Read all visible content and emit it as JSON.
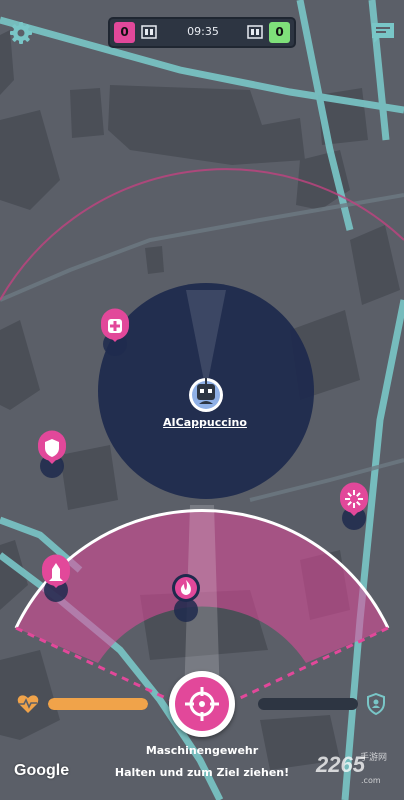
{
  "scoreboard": {
    "left_score": "0",
    "time": "09:35",
    "right_score": "0",
    "left_color": "#e2489a",
    "right_color": "#7fe07a"
  },
  "icons": {
    "settings": "gear-icon",
    "chat": "chat-icon",
    "health": "heart-pulse-icon",
    "shield": "shield-person-icon",
    "fire": "crosshair-icon"
  },
  "player": {
    "name": "AICappuccino",
    "avatar": "robot-avatar"
  },
  "pickups": [
    {
      "type": "medkit",
      "icon": "medkit-icon"
    },
    {
      "type": "shield",
      "icon": "shield-icon"
    },
    {
      "type": "powerup",
      "icon": "sparkle-icon"
    },
    {
      "type": "rocket",
      "icon": "rocket-icon"
    },
    {
      "type": "fire",
      "icon": "flame-icon"
    }
  ],
  "hud": {
    "health_level": 1.0,
    "shield_level": 0.0,
    "health_color": "#f0a34a",
    "weapon_name": "Maschinengewehr",
    "hint": "Halten und zum Ziel ziehen!"
  },
  "map_attribution": "Google",
  "watermark": {
    "main": "2265",
    "suffix": ".com",
    "sub": "手游网"
  },
  "colors": {
    "accent": "#e2489a",
    "range_circle": "#1e2a4d",
    "background": "#5b5f68"
  }
}
